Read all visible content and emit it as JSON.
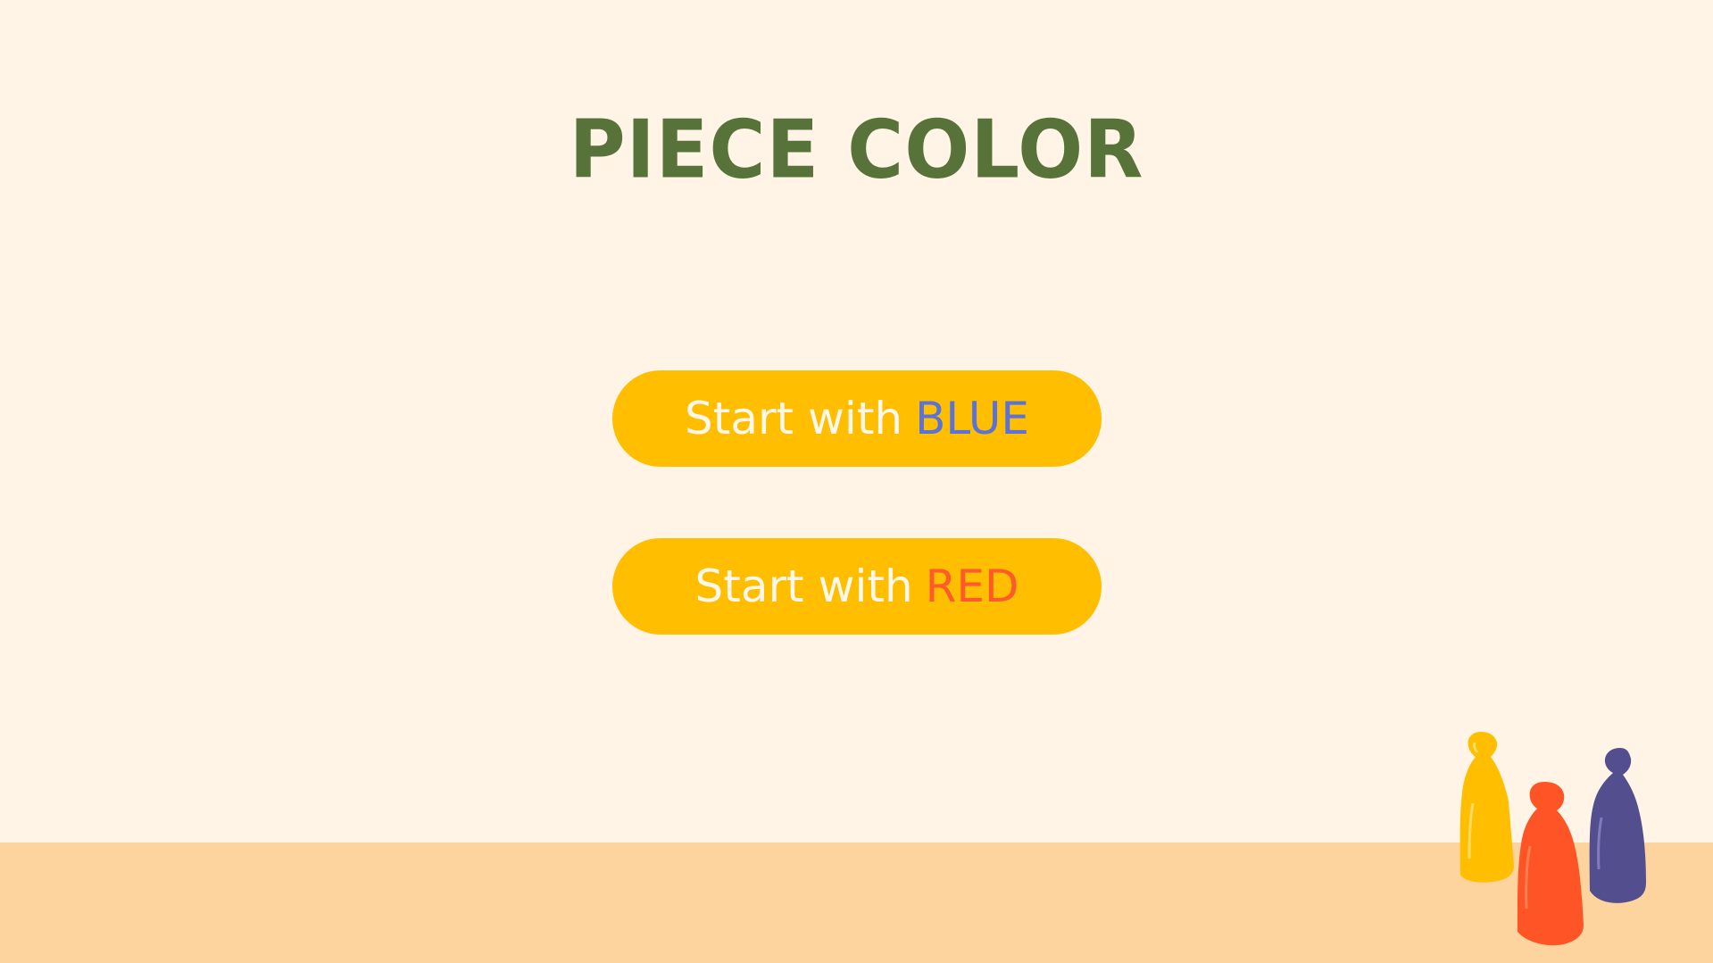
{
  "title": "PIECE COLOR",
  "buttons": {
    "blue": {
      "prefix": "Start with",
      "color_word": "BLUE",
      "color_hex": "#5B73D6"
    },
    "red": {
      "prefix": "Start with",
      "color_word": "RED",
      "color_hex": "#FF5A2C"
    }
  },
  "colors": {
    "background": "#FFF4E6",
    "floor": "#FED49E",
    "title": "#58733A",
    "button": "#FFBF00",
    "button_text": "#FFF7EC"
  },
  "decoration": {
    "pieces": [
      {
        "name": "yellow-pawn-icon",
        "color": "#FFBF00"
      },
      {
        "name": "red-pawn-icon",
        "color": "#FF5426"
      },
      {
        "name": "purple-pawn-icon",
        "color": "#534F8E"
      }
    ]
  }
}
